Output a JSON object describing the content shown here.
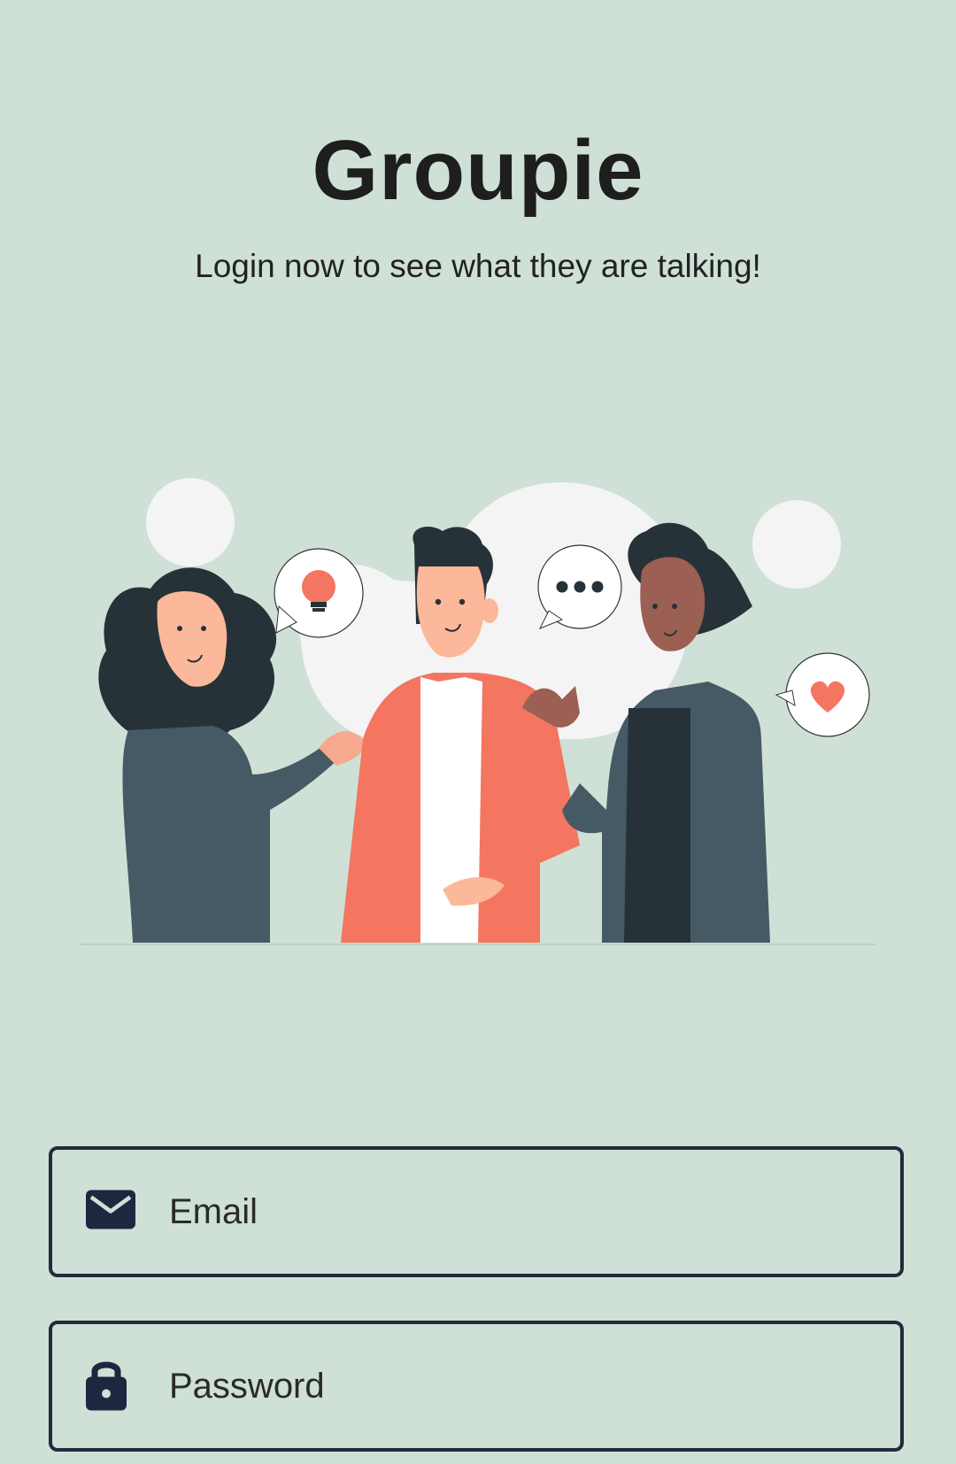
{
  "app": {
    "title": "Groupie",
    "subtitle": "Login now to see what they are talking!"
  },
  "form": {
    "email": {
      "placeholder": "Email",
      "value": "",
      "icon": "envelope-icon"
    },
    "password": {
      "placeholder": "Password",
      "value": "",
      "icon": "lock-icon"
    }
  },
  "colors": {
    "background": "#cfe0d6",
    "accent": "#f47560",
    "border": "#222a3c"
  }
}
